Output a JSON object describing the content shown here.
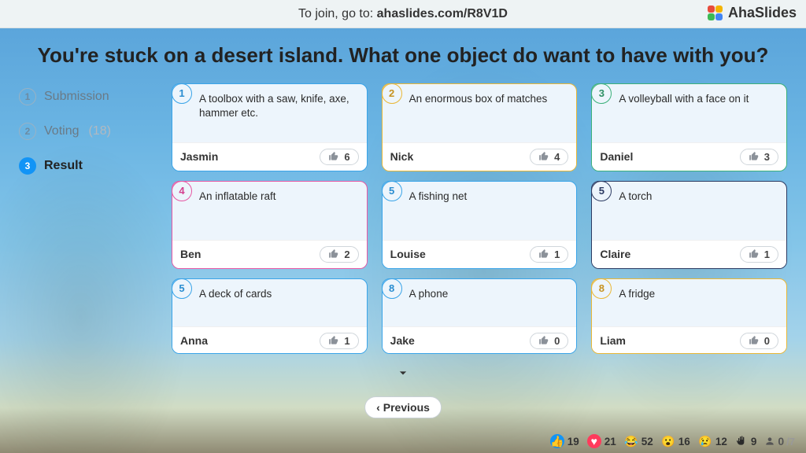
{
  "topbar": {
    "prefix": "To join, go to: ",
    "url": "ahaslides.com/R8V1D"
  },
  "brand": "AhaSlides",
  "question": "You're stuck on a desert island. What one object do want to have with you?",
  "steps": {
    "submission": "Submission",
    "voting": "Voting",
    "voting_count": "(18)",
    "result": "Result"
  },
  "cards": [
    {
      "rank": "1",
      "answer": "A toolbox with a saw, knife, axe, hammer etc.",
      "name": "Jasmin",
      "votes": "6",
      "color": "blue"
    },
    {
      "rank": "2",
      "answer": "An enormous box of matches",
      "name": "Nick",
      "votes": "4",
      "color": "yellow"
    },
    {
      "rank": "3",
      "answer": "A volleyball with a face on it",
      "name": "Daniel",
      "votes": "3",
      "color": "green"
    },
    {
      "rank": "4",
      "answer": "An inflatable raft",
      "name": "Ben",
      "votes": "2",
      "color": "pink"
    },
    {
      "rank": "5",
      "answer": "A fishing net",
      "name": "Louise",
      "votes": "1",
      "color": "blue"
    },
    {
      "rank": "5",
      "answer": "A torch",
      "name": "Claire",
      "votes": "1",
      "color": "navy"
    },
    {
      "rank": "5",
      "answer": "A deck of cards",
      "name": "Anna",
      "votes": "1",
      "color": "blue"
    },
    {
      "rank": "8",
      "answer": "A phone",
      "name": "Jake",
      "votes": "0",
      "color": "blue"
    },
    {
      "rank": "8",
      "answer": "A fridge",
      "name": "Liam",
      "votes": "0",
      "color": "yellow"
    }
  ],
  "prev_label": "Previous",
  "reactions": {
    "like": "19",
    "heart": "21",
    "laugh": "52",
    "wow": "16",
    "sad": "12",
    "hand": "9"
  },
  "participants": {
    "current": "0",
    "max": "/7"
  }
}
